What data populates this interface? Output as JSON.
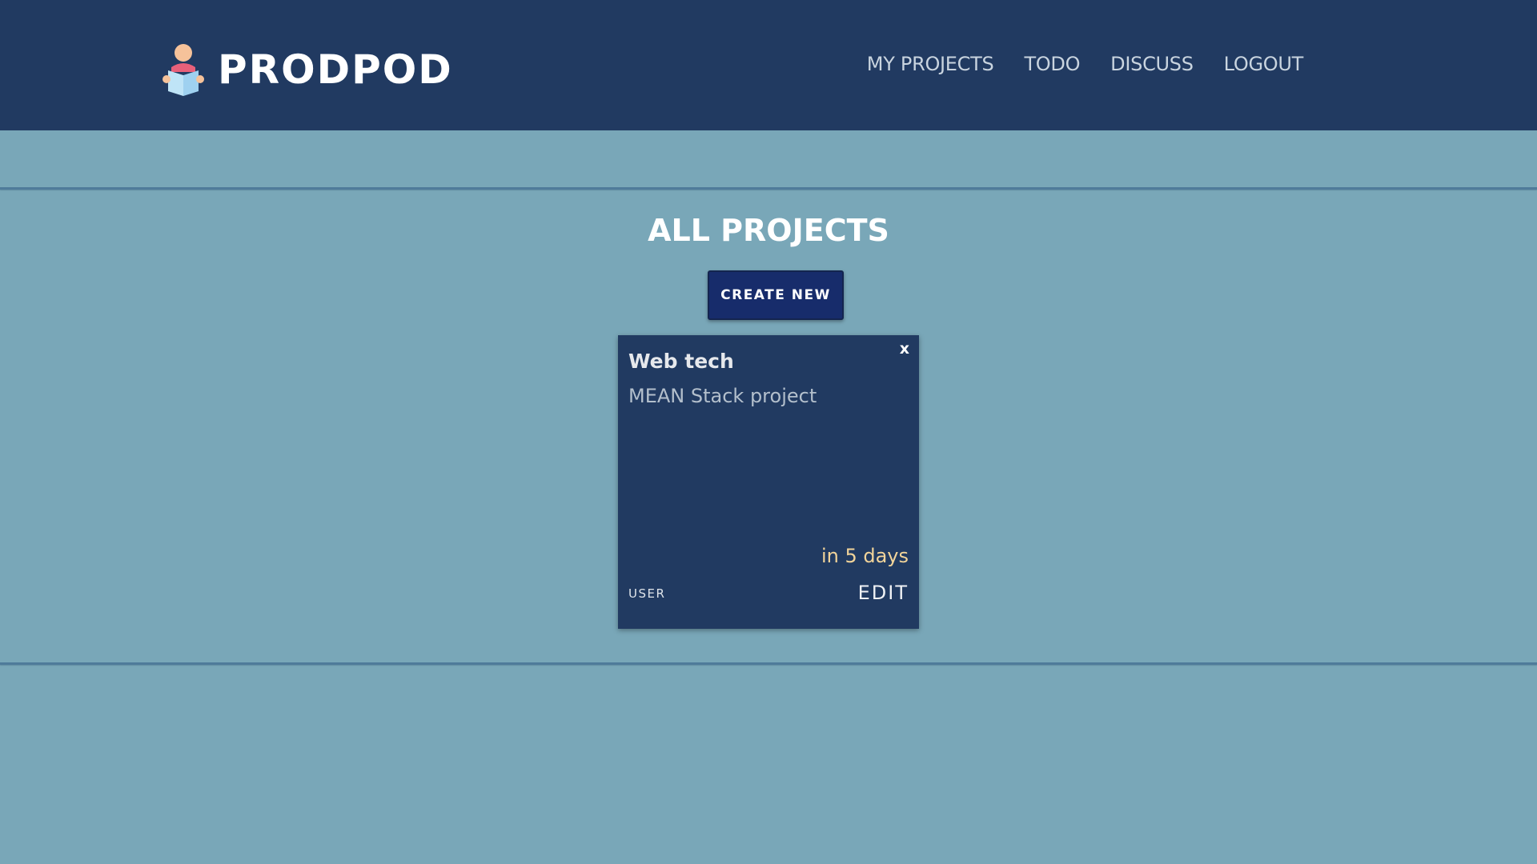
{
  "header": {
    "brand_name": "PRODPOD",
    "logo_icon": "person-reading-icon",
    "nav": [
      {
        "label": "MY PROJECTS"
      },
      {
        "label": "TODO"
      },
      {
        "label": "DISCUSS"
      },
      {
        "label": "LOGOUT"
      }
    ]
  },
  "main": {
    "title": "ALL PROJECTS",
    "create_label": "CREATE NEW",
    "projects": [
      {
        "close_label": "x",
        "name": "Web tech",
        "description": "MEAN Stack project",
        "due": "in 5 days",
        "owner": "USER",
        "edit_label": "EDIT"
      }
    ]
  },
  "colors": {
    "header_bg": "#213a61",
    "page_bg": "#79a7b8",
    "button_bg": "#172c6b",
    "card_bg": "#213a61",
    "due_text": "#f2d49a"
  }
}
